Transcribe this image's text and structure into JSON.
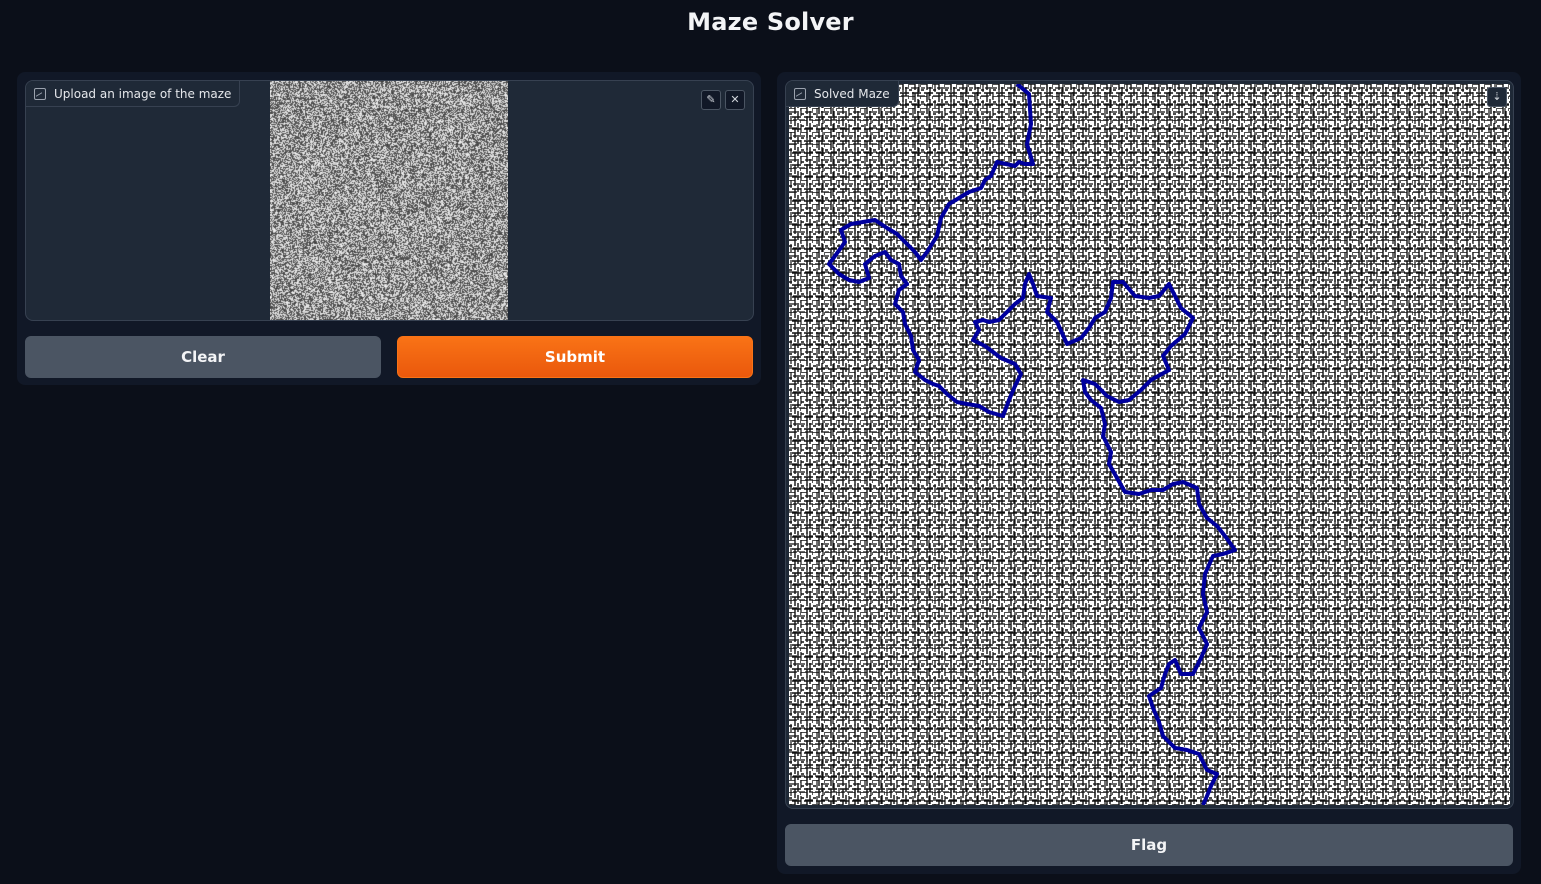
{
  "app": {
    "title": "Maze Solver"
  },
  "input_panel": {
    "label": "Upload an image of the maze",
    "edit_icon": "pencil-icon",
    "close_icon": "close-icon",
    "image_icon": "image-icon"
  },
  "output_panel": {
    "label": "Solved Maze",
    "download_icon": "download-icon",
    "image_icon": "image-icon"
  },
  "buttons": {
    "clear": "Clear",
    "submit": "Submit",
    "flag": "Flag"
  },
  "colors": {
    "background": "#0b0f19",
    "panel": "#111827",
    "accent": "#f97316",
    "secondary_button": "#4b5563",
    "solution_path": "#0000aa"
  }
}
